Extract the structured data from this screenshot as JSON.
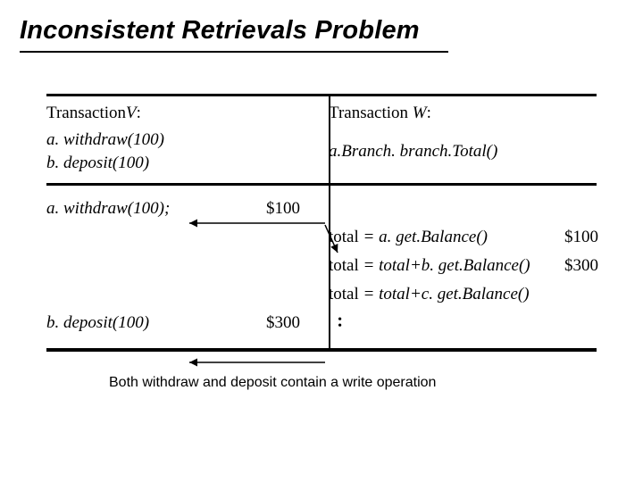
{
  "title": "Inconsistent Retrievals Problem",
  "header": {
    "txnV_label_pre": "Transaction",
    "txnV_label_var": "V",
    "txnV_label_post": ":",
    "txnW_label_pre": "Transaction ",
    "txnW_label_var": "W",
    "txnW_label_post": ":"
  },
  "subheader": {
    "v_line1": "a. withdraw(100)",
    "v_line2": "b. deposit(100)",
    "w_line1": "a.Branch. branch.Total()"
  },
  "rows": [
    {
      "opV": "a. withdraw(100);",
      "amtV": "$100",
      "opW": "",
      "amtW": ""
    },
    {
      "opV": "",
      "amtV": "",
      "opW_pre": "total",
      "opW_mid": " = a. get.Balance()",
      "opW": "",
      "amtW": "$100"
    },
    {
      "opV": "",
      "amtV": "",
      "opW_pre": "total",
      "opW_mid": " = total+b. get.Balance()",
      "opW": "",
      "amtW": "$300"
    },
    {
      "opV": "",
      "amtV": "",
      "opW_pre": "total",
      "opW_mid": " = total+c. get.Balance()",
      "opW": "",
      "amtW": ""
    },
    {
      "opV": "b. deposit(100)",
      "amtV": "$300",
      "opW": "",
      "amtW": ""
    }
  ],
  "footnote": "Both withdraw and deposit contain a write operation",
  "dots": "•\n•"
}
